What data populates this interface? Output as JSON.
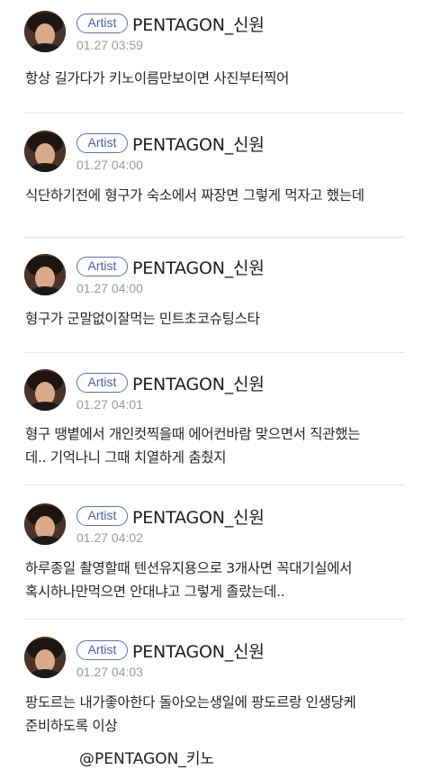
{
  "posts": [
    {
      "badge": "Artist",
      "name": "PENTAGON_신원",
      "time": "01.27 03:59",
      "text": "항상 길가다가 키노이름만보이면 사진부터찍어"
    },
    {
      "badge": "Artist",
      "name": "PENTAGON_신원",
      "time": "01.27 04:00",
      "text": "식단하기전에 형구가 숙소에서 짜장면 그렇게 먹자고 했는데"
    },
    {
      "badge": "Artist",
      "name": "PENTAGON_신원",
      "time": "01.27 04:00",
      "text": "형구가 군말없이잘먹는 민트초코슈팅스타"
    },
    {
      "badge": "Artist",
      "name": "PENTAGON_신원",
      "time": "01.27 04:01",
      "text": "형구 땡볕에서 개인컷찍을때 에어컨바람 맞으면서 직관했는\n데.. 기억나니 그때 치열하게 춤췄지"
    },
    {
      "badge": "Artist",
      "name": "PENTAGON_신원",
      "time": "01.27 04:02",
      "text": "하루종일 촬영할때 텐션유지용으로 3개사면 꼭대기실에서\n혹시하나만먹으면 안대냐고 그렇게 졸랐는데.."
    },
    {
      "badge": "Artist",
      "name": "PENTAGON_신원",
      "time": "01.27 04:03",
      "text": " 팡도르는 내가좋아한다 돌아오는생일에 팡도르랑 인생당케\n준비하도록 이상"
    }
  ],
  "credit": "@PENTAGON_키노"
}
